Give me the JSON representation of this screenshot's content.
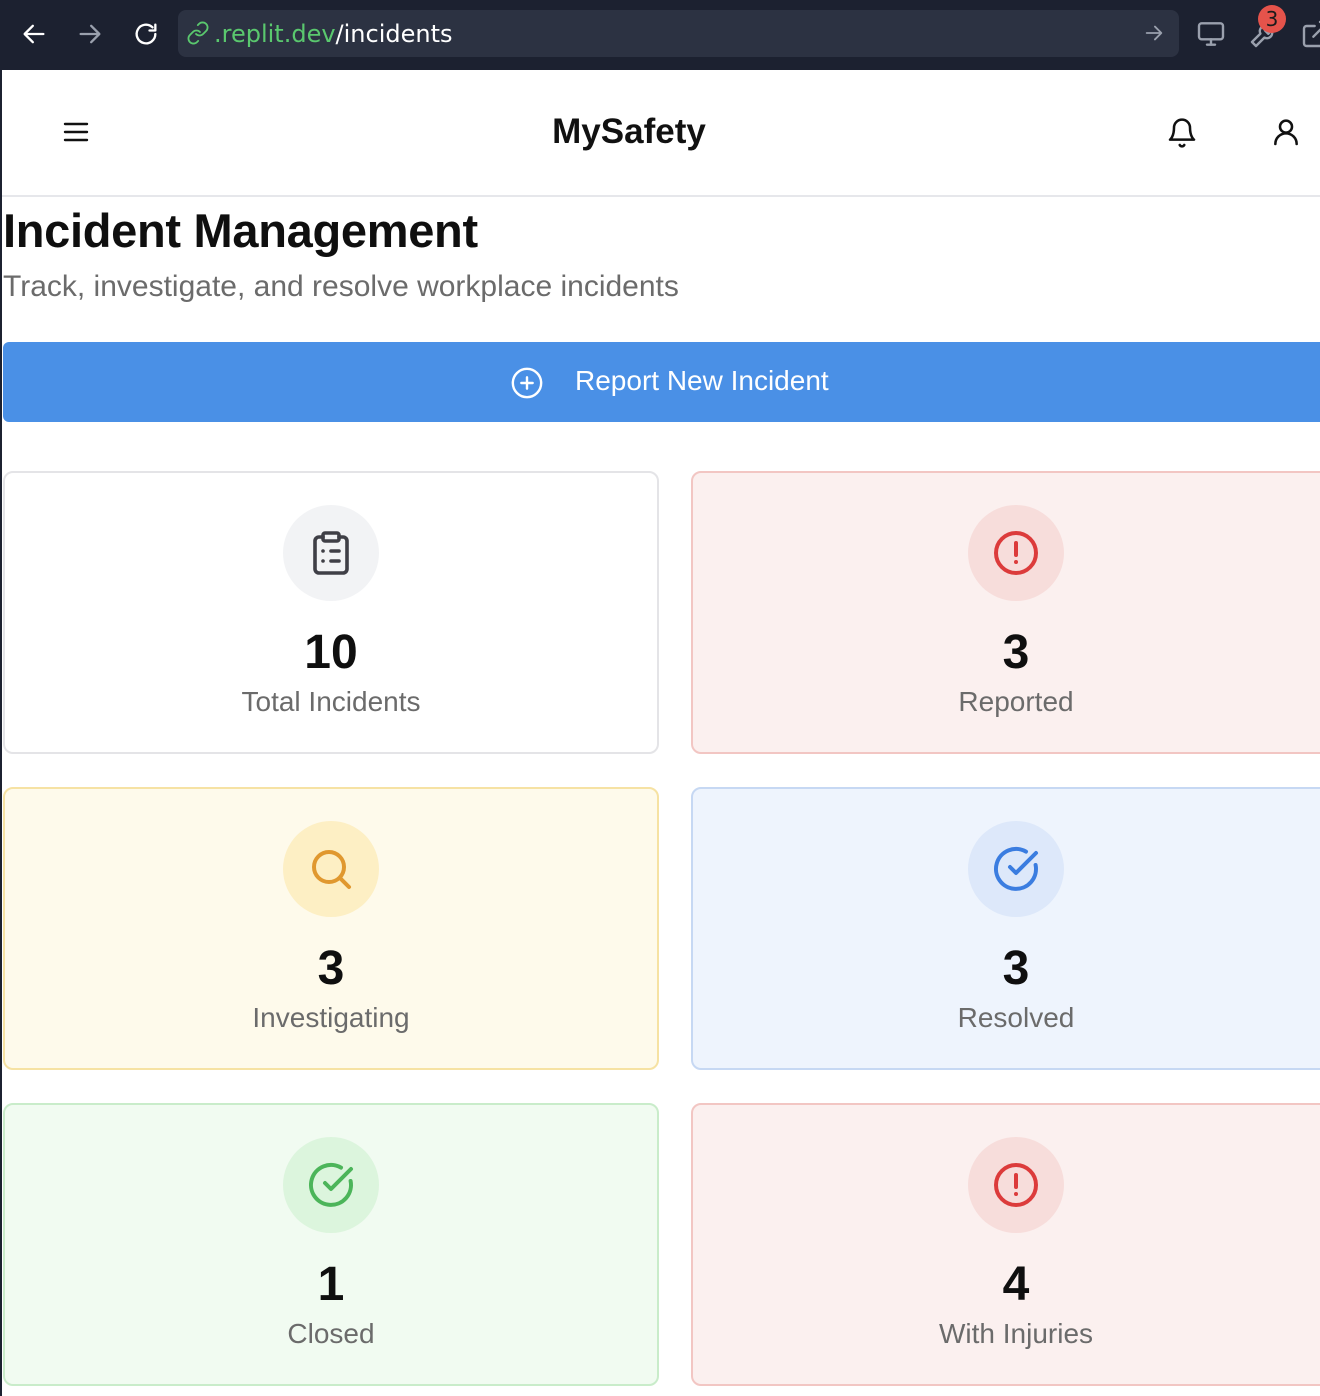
{
  "browser": {
    "url_domain": ".replit.dev",
    "url_path": "/incidents",
    "extension_badge": "3"
  },
  "header": {
    "title": "MySafety"
  },
  "page": {
    "title": "Incident Management",
    "subtitle": "Track, investigate, and resolve workplace incidents",
    "report_button": "Report New Incident"
  },
  "stats": [
    {
      "value": "10",
      "label": "Total Incidents",
      "icon": "clipboard-list-icon",
      "color": "#3f3f46"
    },
    {
      "value": "3",
      "label": "Reported",
      "icon": "alert-circle-icon",
      "color": "#dc3b3b"
    },
    {
      "value": "3",
      "label": "Investigating",
      "icon": "search-icon",
      "color": "#e0982f"
    },
    {
      "value": "3",
      "label": "Resolved",
      "icon": "check-circle-icon",
      "color": "#3b7de0"
    },
    {
      "value": "1",
      "label": "Closed",
      "icon": "check-circle-icon",
      "color": "#4cb55a"
    },
    {
      "value": "4",
      "label": "With Injuries",
      "icon": "alert-circle-icon",
      "color": "#dc3b3b"
    }
  ],
  "colors": {
    "accent": "#4a90e6",
    "reported_bg": "#fbf0ef",
    "investigating_bg": "#fefaeb",
    "resolved_bg": "#eef4fd",
    "closed_bg": "#f1fbf1"
  }
}
